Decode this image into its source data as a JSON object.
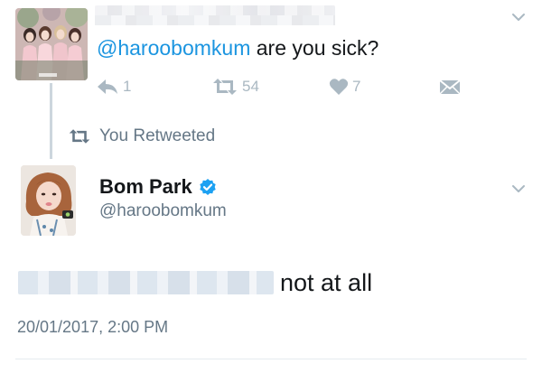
{
  "reply_tweet": {
    "mention": "@haroobomkum",
    "text": " are you sick?",
    "counts": {
      "replies": "1",
      "retweets": "54",
      "likes": "7"
    },
    "icons": {
      "reply": "reply-icon",
      "retweet": "retweet-icon",
      "like": "heart-icon",
      "dm": "direct-message-icon",
      "menu": "chevron-down-icon"
    }
  },
  "retweet_context": {
    "label": "You Retweeted",
    "icon": "retweet-icon"
  },
  "main_tweet": {
    "display_name": "Bom Park",
    "verified_icon": "verified-badge-icon",
    "handle": "@haroobomkum",
    "text": "not at all",
    "timestamp": "20/01/2017, 2:00 PM",
    "menu_icon": "chevron-down-icon"
  },
  "colors": {
    "accent": "#1b95e0",
    "muted": "#657786",
    "icon_gray": "#aab8c2",
    "text": "#14171a"
  }
}
